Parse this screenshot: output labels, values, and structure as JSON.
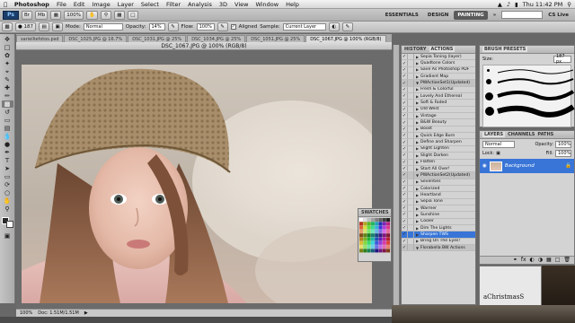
{
  "menubar": {
    "app": "Photoshop",
    "items": [
      "File",
      "Edit",
      "Image",
      "Layer",
      "Select",
      "Filter",
      "Analysis",
      "3D",
      "View",
      "Window",
      "Help"
    ],
    "clock": "Thu 11:42 PM"
  },
  "appbar": {
    "logo": "Ps",
    "zoom": "100%",
    "workspaces": [
      "ESSENTIALS",
      "DESIGN",
      "PAINTING"
    ],
    "cs_live": "CS Live"
  },
  "options": {
    "mode_label": "Mode:",
    "mode_value": "Normal",
    "opacity_label": "Opacity:",
    "opacity_value": "14%",
    "flow_label": "Flow:",
    "flow_value": "100%",
    "aligned_label": "Aligned",
    "sample_label": "Sample:",
    "sample_value": "Current Layer"
  },
  "doc_tabs": [
    "sarielliefotos.psd",
    "DSC_1025.JPG @ 16.7%",
    "DSC_1031.JPG @ 25%",
    "DSC_1034.JPG @ 25%",
    "DSC_1051.JPG @ 25%",
    "DSC_1067.JPG @ 100% (RGB/8)"
  ],
  "window_title": "DSC_1067.JPG @ 100% (RGB/8)",
  "status": {
    "zoom": "100%",
    "doc": "Doc: 1.51M/1.51M"
  },
  "actions_panel": {
    "tabs": [
      "HISTORY",
      "ACTIONS"
    ],
    "rows": [
      {
        "label": "Sepia Toning (layer)",
        "type": "item"
      },
      {
        "label": "Quadtone Colors",
        "type": "item"
      },
      {
        "label": "Save As Photoshop PDF",
        "type": "item"
      },
      {
        "label": "Gradient Map",
        "type": "item"
      },
      {
        "label": "PWActionSet1(Updated)",
        "type": "set"
      },
      {
        "label": "Fresh & Colorful",
        "type": "item"
      },
      {
        "label": "Lovely And Ethereal",
        "type": "item"
      },
      {
        "label": "Soft & Faded",
        "type": "item"
      },
      {
        "label": "Old West",
        "type": "item"
      },
      {
        "label": "Vintage",
        "type": "item"
      },
      {
        "label": "B&W Beauty",
        "type": "item"
      },
      {
        "label": "Boost",
        "type": "item"
      },
      {
        "label": "Quick Edge Burn",
        "type": "item"
      },
      {
        "label": "Define and Sharpen",
        "type": "item"
      },
      {
        "label": "Slight Lighten",
        "type": "item"
      },
      {
        "label": "Slight Darken",
        "type": "item"
      },
      {
        "label": "Flatten",
        "type": "item"
      },
      {
        "label": "Start All Over!",
        "type": "item"
      },
      {
        "label": "PWActionSet2(Updated)",
        "type": "set"
      },
      {
        "label": "Seventies",
        "type": "item"
      },
      {
        "label": "Colorized",
        "type": "item"
      },
      {
        "label": "Heartland",
        "type": "item"
      },
      {
        "label": "Sepia Tone",
        "type": "item"
      },
      {
        "label": "Warmer",
        "type": "item"
      },
      {
        "label": "Sunshine",
        "type": "item"
      },
      {
        "label": "Cooler",
        "type": "item"
      },
      {
        "label": "Dim The Lights",
        "type": "item"
      },
      {
        "label": "Sharpen TWS",
        "type": "selected"
      },
      {
        "label": "Bring On The Eyes!",
        "type": "item"
      },
      {
        "label": "Florabella BW Actions",
        "type": "set"
      }
    ]
  },
  "brush_panel": {
    "title": "BRUSH PRESETS",
    "size_label": "Size:",
    "size_value": "187 px"
  },
  "layers_panel": {
    "tabs": [
      "LAYERS",
      "CHANNELS",
      "PATHS"
    ],
    "blend": "Normal",
    "opacity_label": "Opacity:",
    "opacity_value": "100%",
    "lock_label": "Lock:",
    "fill_label": "Fill:",
    "fill_value": "100%",
    "layer_name": "Background"
  },
  "swatches_panel": {
    "title": "SWATCHES"
  },
  "corner_text": "aChristmasS",
  "colors": {
    "selection": "#3875d7",
    "panel": "#d3d3d3",
    "workspace_bg": "#6b6b6b"
  }
}
